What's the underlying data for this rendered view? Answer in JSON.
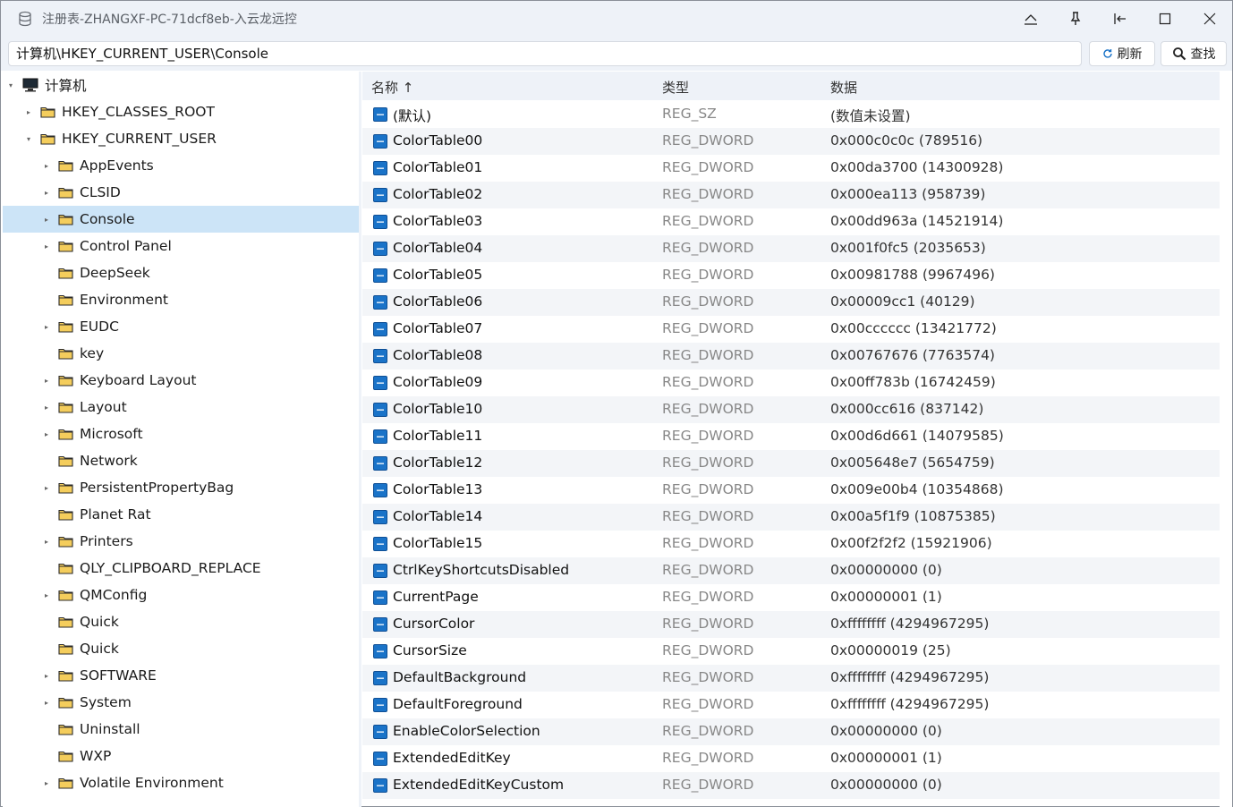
{
  "window": {
    "title": "注册表-ZHANGXF-PC-71dcf8eb-入云龙远控",
    "controls": [
      "chevron-up-icon",
      "pin-icon",
      "collapse-left-icon",
      "maximize-icon",
      "close-icon"
    ]
  },
  "address": {
    "path": "计算机\\HKEY_CURRENT_USER\\Console",
    "refresh_label": "刷新",
    "search_label": "查找"
  },
  "tree": {
    "items": [
      {
        "label": "计算机",
        "level": 0,
        "arrow": "▾",
        "icon": "computer-icon"
      },
      {
        "label": "HKEY_CLASSES_ROOT",
        "level": 1,
        "arrow": "▸",
        "icon": "folder-icon"
      },
      {
        "label": "HKEY_CURRENT_USER",
        "level": 1,
        "arrow": "▾",
        "icon": "folder-icon"
      },
      {
        "label": "AppEvents",
        "level": 2,
        "arrow": "▸",
        "icon": "folder-icon"
      },
      {
        "label": "CLSID",
        "level": 2,
        "arrow": "▸",
        "icon": "folder-icon"
      },
      {
        "label": "Console",
        "level": 2,
        "arrow": "▸",
        "icon": "folder-icon",
        "selected": true
      },
      {
        "label": "Control Panel",
        "level": 2,
        "arrow": "▸",
        "icon": "folder-icon"
      },
      {
        "label": "DeepSeek",
        "level": 2,
        "arrow": "",
        "icon": "folder-icon"
      },
      {
        "label": "Environment",
        "level": 2,
        "arrow": "",
        "icon": "folder-icon"
      },
      {
        "label": "EUDC",
        "level": 2,
        "arrow": "▸",
        "icon": "folder-icon"
      },
      {
        "label": "key",
        "level": 2,
        "arrow": "",
        "icon": "folder-icon"
      },
      {
        "label": "Keyboard Layout",
        "level": 2,
        "arrow": "▸",
        "icon": "folder-icon"
      },
      {
        "label": "Layout",
        "level": 2,
        "arrow": "▸",
        "icon": "folder-icon"
      },
      {
        "label": "Microsoft",
        "level": 2,
        "arrow": "▸",
        "icon": "folder-icon"
      },
      {
        "label": "Network",
        "level": 2,
        "arrow": "",
        "icon": "folder-icon"
      },
      {
        "label": "PersistentPropertyBag",
        "level": 2,
        "arrow": "▸",
        "icon": "folder-icon"
      },
      {
        "label": "Planet Rat",
        "level": 2,
        "arrow": "",
        "icon": "folder-icon"
      },
      {
        "label": "Printers",
        "level": 2,
        "arrow": "▸",
        "icon": "folder-icon"
      },
      {
        "label": "QLY_CLIPBOARD_REPLACE",
        "level": 2,
        "arrow": "",
        "icon": "folder-icon"
      },
      {
        "label": "QMConfig",
        "level": 2,
        "arrow": "▸",
        "icon": "folder-icon"
      },
      {
        "label": "Quick",
        "level": 2,
        "arrow": "",
        "icon": "folder-icon"
      },
      {
        "label": "Quick",
        "level": 2,
        "arrow": "",
        "icon": "folder-icon"
      },
      {
        "label": "SOFTWARE",
        "level": 2,
        "arrow": "▸",
        "icon": "folder-icon"
      },
      {
        "label": "System",
        "level": 2,
        "arrow": "▸",
        "icon": "folder-icon"
      },
      {
        "label": "Uninstall",
        "level": 2,
        "arrow": "",
        "icon": "folder-icon"
      },
      {
        "label": "WXP",
        "level": 2,
        "arrow": "",
        "icon": "folder-icon"
      },
      {
        "label": "Volatile Environment",
        "level": 2,
        "arrow": "▸",
        "icon": "folder-icon"
      }
    ]
  },
  "list": {
    "headers": {
      "name": "名称 ↑",
      "type": "类型",
      "data": "数据"
    },
    "rows": [
      {
        "name": "(默认)",
        "type": "REG_SZ",
        "data": "(数值未设置)"
      },
      {
        "name": "ColorTable00",
        "type": "REG_DWORD",
        "data": "0x000c0c0c (789516)"
      },
      {
        "name": "ColorTable01",
        "type": "REG_DWORD",
        "data": "0x00da3700 (14300928)"
      },
      {
        "name": "ColorTable02",
        "type": "REG_DWORD",
        "data": "0x000ea113 (958739)"
      },
      {
        "name": "ColorTable03",
        "type": "REG_DWORD",
        "data": "0x00dd963a (14521914)"
      },
      {
        "name": "ColorTable04",
        "type": "REG_DWORD",
        "data": "0x001f0fc5 (2035653)"
      },
      {
        "name": "ColorTable05",
        "type": "REG_DWORD",
        "data": "0x00981788 (9967496)"
      },
      {
        "name": "ColorTable06",
        "type": "REG_DWORD",
        "data": "0x00009cc1 (40129)"
      },
      {
        "name": "ColorTable07",
        "type": "REG_DWORD",
        "data": "0x00cccccc (13421772)"
      },
      {
        "name": "ColorTable08",
        "type": "REG_DWORD",
        "data": "0x00767676 (7763574)"
      },
      {
        "name": "ColorTable09",
        "type": "REG_DWORD",
        "data": "0x00ff783b (16742459)"
      },
      {
        "name": "ColorTable10",
        "type": "REG_DWORD",
        "data": "0x000cc616 (837142)"
      },
      {
        "name": "ColorTable11",
        "type": "REG_DWORD",
        "data": "0x00d6d661 (14079585)"
      },
      {
        "name": "ColorTable12",
        "type": "REG_DWORD",
        "data": "0x005648e7 (5654759)"
      },
      {
        "name": "ColorTable13",
        "type": "REG_DWORD",
        "data": "0x009e00b4 (10354868)"
      },
      {
        "name": "ColorTable14",
        "type": "REG_DWORD",
        "data": "0x00a5f1f9 (10875385)"
      },
      {
        "name": "ColorTable15",
        "type": "REG_DWORD",
        "data": "0x00f2f2f2 (15921906)"
      },
      {
        "name": "CtrlKeyShortcutsDisabled",
        "type": "REG_DWORD",
        "data": "0x00000000 (0)"
      },
      {
        "name": "CurrentPage",
        "type": "REG_DWORD",
        "data": "0x00000001 (1)"
      },
      {
        "name": "CursorColor",
        "type": "REG_DWORD",
        "data": "0xffffffff (4294967295)"
      },
      {
        "name": "CursorSize",
        "type": "REG_DWORD",
        "data": "0x00000019 (25)"
      },
      {
        "name": "DefaultBackground",
        "type": "REG_DWORD",
        "data": "0xffffffff (4294967295)"
      },
      {
        "name": "DefaultForeground",
        "type": "REG_DWORD",
        "data": "0xffffffff (4294967295)"
      },
      {
        "name": "EnableColorSelection",
        "type": "REG_DWORD",
        "data": "0x00000000 (0)"
      },
      {
        "name": "ExtendedEditKey",
        "type": "REG_DWORD",
        "data": "0x00000001 (1)"
      },
      {
        "name": "ExtendedEditKeyCustom",
        "type": "REG_DWORD",
        "data": "0x00000000 (0)"
      }
    ]
  },
  "colors": {
    "chrome_bg": "#eef2f8",
    "selected_bg": "#cce4f7",
    "value_icon": "#1a73c8",
    "folder": "#f0c24b"
  }
}
